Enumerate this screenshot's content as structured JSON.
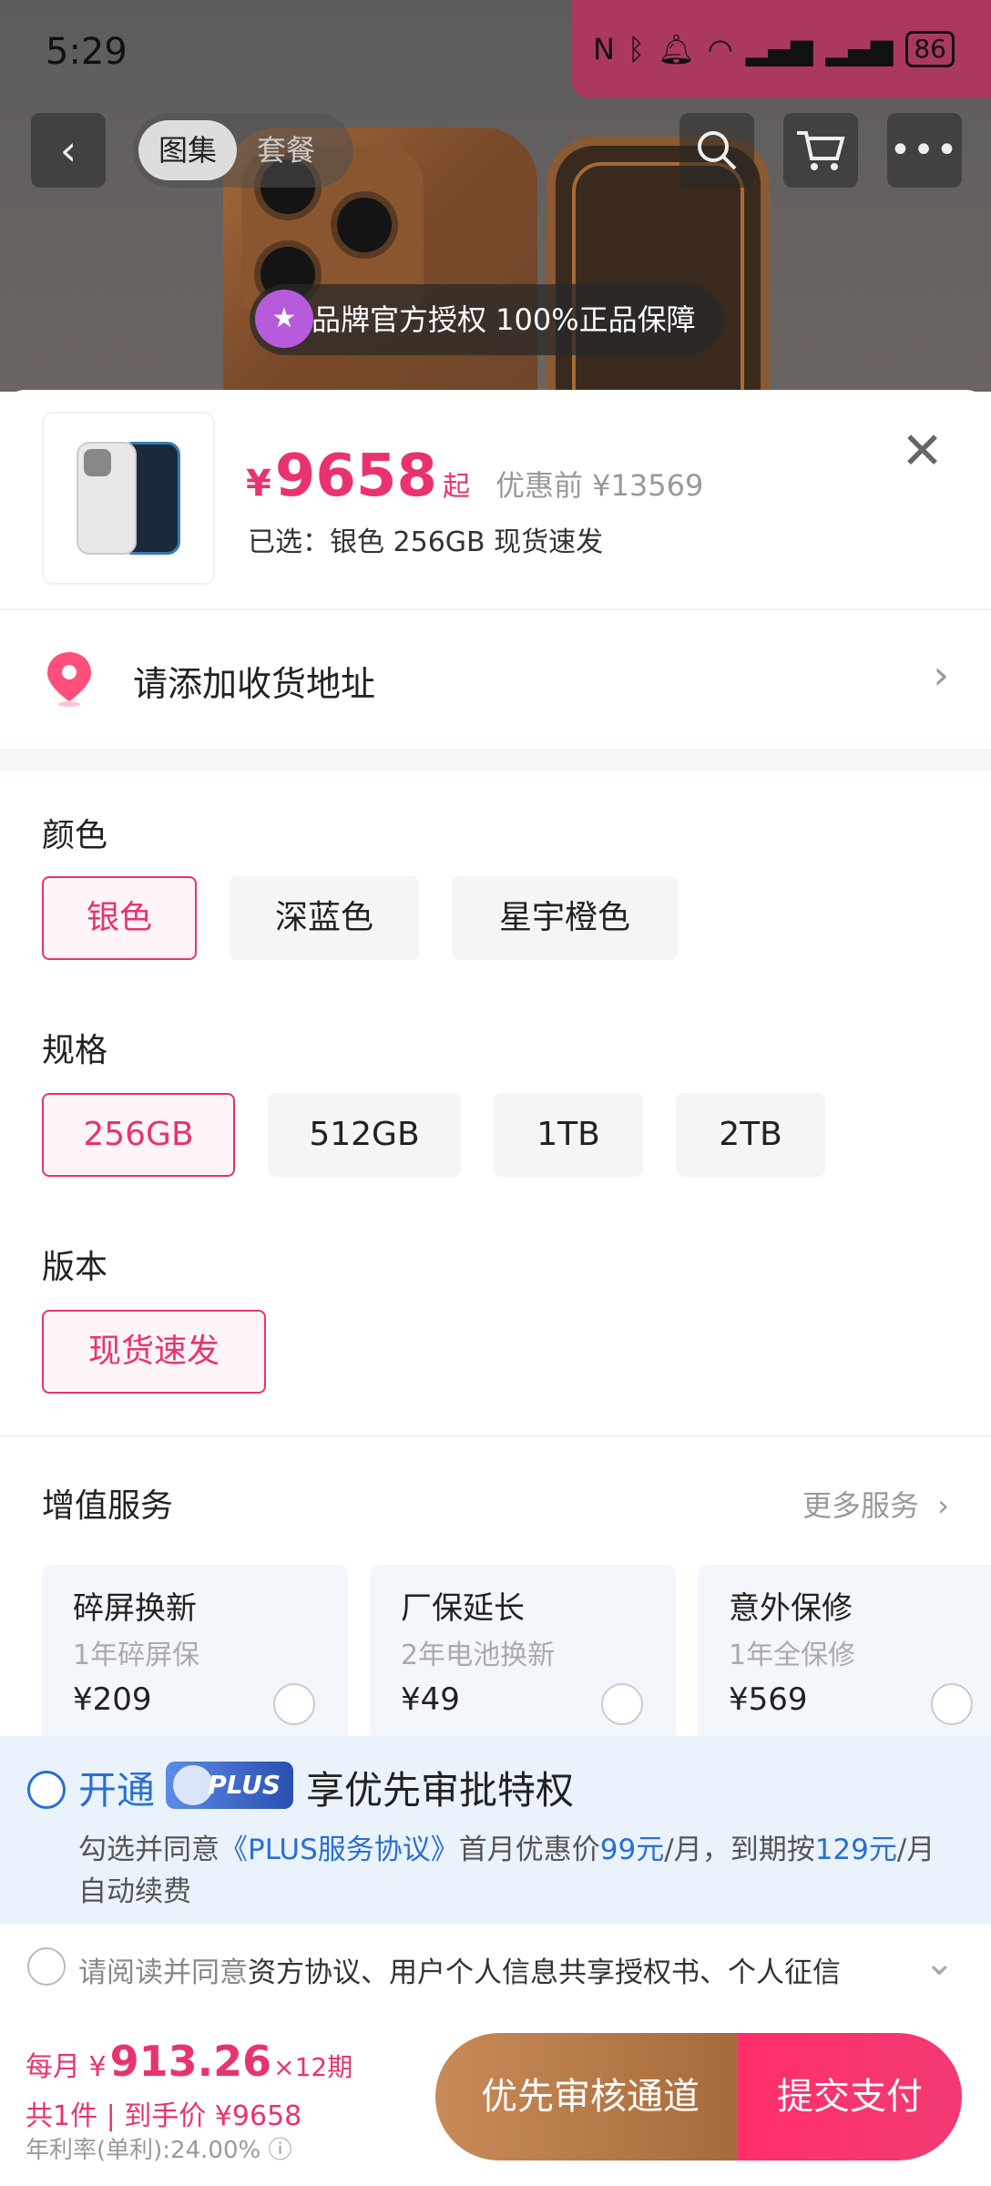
{
  "status_bar": {
    "time": "5:29",
    "battery": "86"
  },
  "nav": {
    "tabs": [
      {
        "label": "图集"
      },
      {
        "label": "套餐"
      }
    ]
  },
  "brand_badge": "品牌官方授权 100%正品保障",
  "product": {
    "price_symbol": "¥",
    "price": "9658",
    "price_suffix": "起",
    "original_price": "优惠前 ¥13569",
    "selected": "已选：银色 256GB 现货速发"
  },
  "address": {
    "label": "请添加收货地址"
  },
  "sections": {
    "color": {
      "title": "颜色",
      "options": [
        "银色",
        "深蓝色",
        "星宇橙色"
      ],
      "selected": "银色"
    },
    "spec": {
      "title": "规格",
      "options": [
        "256GB",
        "512GB",
        "1TB",
        "2TB"
      ],
      "selected": "256GB"
    },
    "version": {
      "title": "版本",
      "options": [
        "现货速发"
      ],
      "selected": "现货速发"
    }
  },
  "services": {
    "title": "增值服务",
    "more": "更多服务",
    "items": [
      {
        "title": "碎屏换新",
        "sub": "1年碎屏保",
        "price": "¥209"
      },
      {
        "title": "厂保延长",
        "sub": "2年电池换新",
        "price": "¥49"
      },
      {
        "title": "意外保修",
        "sub": "1年全保修",
        "price": "¥569"
      }
    ]
  },
  "plus": {
    "open": "开通",
    "badge": "PLUS",
    "headline": "享优先审批特权",
    "desc_prefix": "勾选并同意",
    "desc_link": "《PLUS服务协议》",
    "desc_mid1": "首月优惠价",
    "first_month": "99元",
    "desc_mid2": "/月，到期按",
    "renew_price": "129元",
    "desc_suffix": "/月自动续费"
  },
  "agreement": {
    "prefix": "请阅读并同意",
    "docs": "资方协议、用户个人信息共享授权书、个人征信"
  },
  "bottom": {
    "monthly_label": "每月 ¥",
    "monthly_amount": "913.26",
    "periods": "×12期",
    "summary": "共1件 | 到手价 ¥9658",
    "rate": "年利率(单利):24.00%",
    "btn_priority": "优先审核通道",
    "btn_submit": "提交支付"
  },
  "colors": {
    "accent": "#e8336e",
    "plus_blue": "#2a6fd0",
    "priority_btn": "#b87a48"
  }
}
